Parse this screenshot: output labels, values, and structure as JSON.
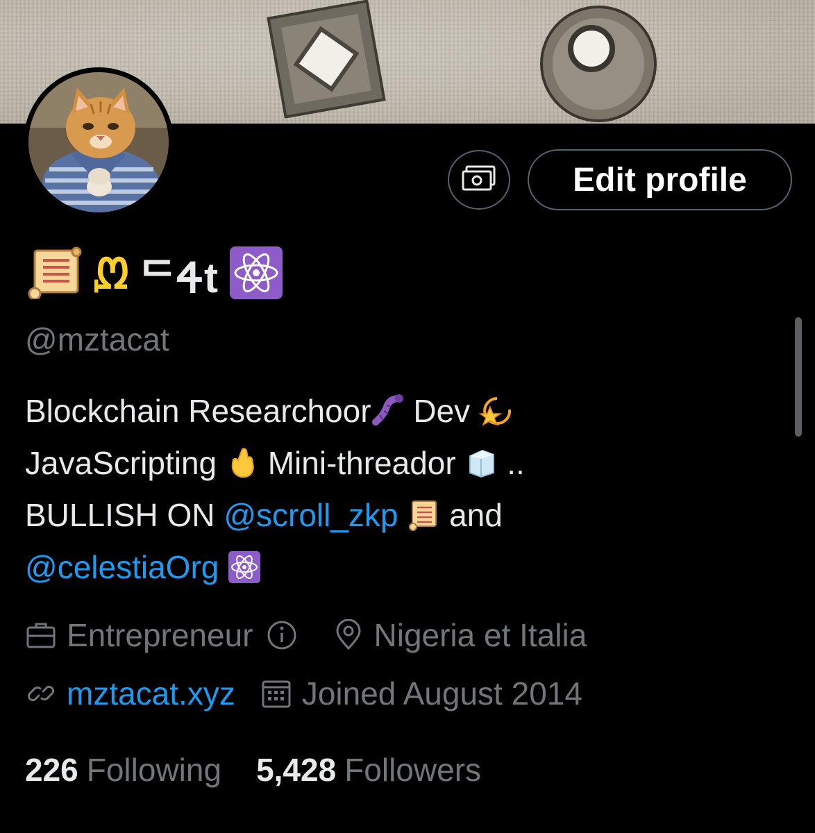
{
  "profile": {
    "display_name_suffix": "t",
    "display_name_m_glyph": "ᘻ",
    "display_name_z_glyph": "ᄃ",
    "display_name_a_glyph": "Ꮞ",
    "handle": "@mztacat",
    "edit_profile_label": "Edit profile",
    "bio": {
      "line1_a": "Blockchain Researchoor",
      "line1_b": "Dev",
      "line2_a": "JavaScripting",
      "line2_b": "Mini-threador",
      "line2_c": "..",
      "line3_a": "BULLISH ON",
      "line3_link": "@scroll_zkp",
      "line3_b": "and",
      "line4_link": "@celestiaOrg"
    },
    "profession": "Entrepreneur",
    "location": "Nigeria et Italia",
    "website": "mztacat.xyz",
    "joined": "Joined August 2014",
    "following_count": "226",
    "following_label": "Following",
    "followers_count": "5,428",
    "followers_label": "Followers"
  },
  "icons": {
    "money": "money-icon",
    "briefcase": "briefcase-icon",
    "info": "info-icon",
    "location": "location-pin-icon",
    "link": "link-icon",
    "calendar": "calendar-icon"
  },
  "colors": {
    "background": "#000000",
    "primary_text": "#e7e9ea",
    "secondary_text": "#71767b",
    "link": "#1d9bf0",
    "button_border": "#536471",
    "emoji_purple": "#8e5cc9"
  }
}
